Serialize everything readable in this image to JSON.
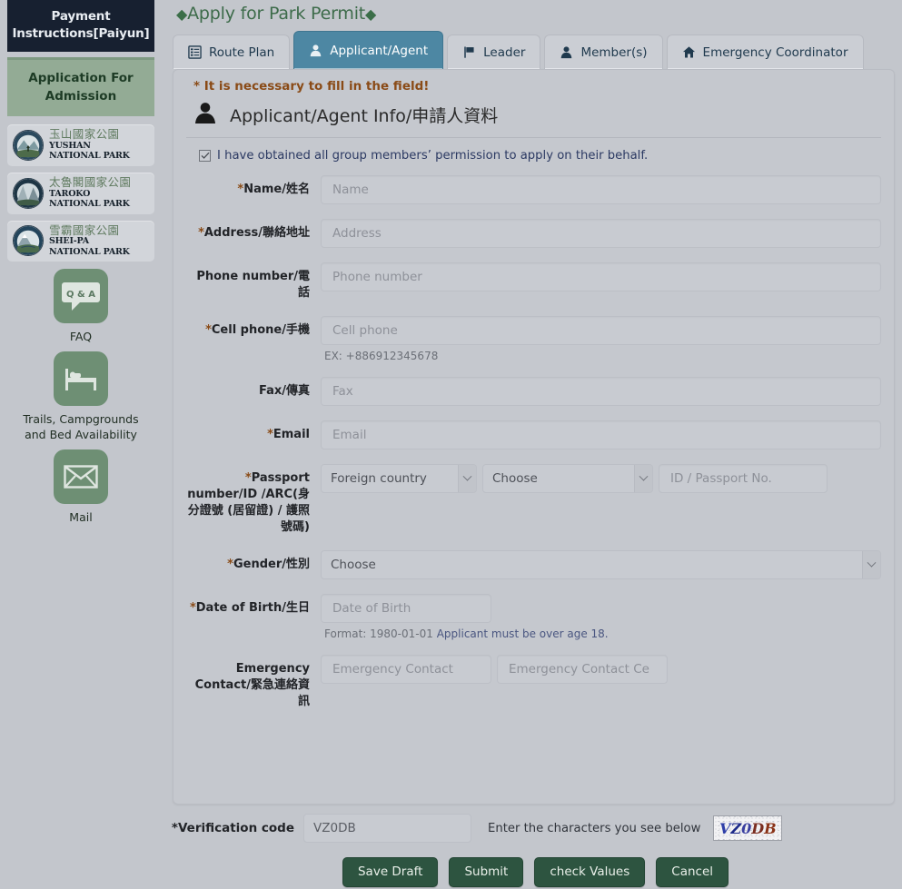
{
  "sidebar": {
    "payment_banner": "Payment Instructions[Paiyun]",
    "admission_banner": "Application For Admission",
    "parks": [
      {
        "cn": "玉山國家公園",
        "en_line1": "YUSHAN",
        "en_line2": "NATIONAL PARK",
        "icon": "yushan-park-seal-icon"
      },
      {
        "cn": "太魯閣國家公園",
        "en_line1": "TAROKO",
        "en_line2": "NATIONAL PARK",
        "icon": "taroko-park-seal-icon"
      },
      {
        "cn": "雪霸國家公園",
        "en_line1": "SHEI-PA",
        "en_line2": "NATIONAL PARK",
        "icon": "sheipa-park-seal-icon"
      }
    ],
    "quick_links": [
      {
        "label": "FAQ",
        "icon": "qa-speech-bubble-icon",
        "glyph": "Q & A"
      },
      {
        "label": "Trails, Campgrounds and Bed Availability",
        "icon": "bed-icon"
      },
      {
        "label": "Mail",
        "icon": "envelope-icon"
      }
    ]
  },
  "header": {
    "title": "Apply for Park Permit",
    "diamond_left": "◆",
    "diamond_right": "◆"
  },
  "tabs": [
    {
      "label": "Route Plan",
      "icon": "list-document-icon",
      "active": false
    },
    {
      "label": "Applicant/Agent",
      "icon": "person-icon",
      "active": true
    },
    {
      "label": "Leader",
      "icon": "flag-icon",
      "active": false
    },
    {
      "label": "Member(s)",
      "icon": "person-icon",
      "active": false
    },
    {
      "label": "Emergency Coordinator",
      "icon": "home-icon",
      "active": false
    }
  ],
  "form": {
    "required_note": "* It is necessary to fill in the field!",
    "section_title": "Applicant/Agent Info/申請人資料",
    "section_icon": "person-avatar-icon",
    "consent_label": "I have obtained all group members’ permission to apply on their behalf.",
    "consent_checked": true,
    "fields": {
      "name": {
        "label": "Name/姓名",
        "required": true,
        "placeholder": "Name",
        "value": ""
      },
      "address": {
        "label": "Address/聯絡地址",
        "required": true,
        "placeholder": "Address",
        "value": ""
      },
      "phone": {
        "label": "Phone number/電話",
        "required": false,
        "placeholder": "Phone number",
        "value": ""
      },
      "cell": {
        "label": "Cell phone/手機",
        "required": true,
        "placeholder": "Cell phone",
        "value": "",
        "hint": "EX: +886912345678"
      },
      "fax": {
        "label": "Fax/傳真",
        "required": false,
        "placeholder": "Fax",
        "value": ""
      },
      "email": {
        "label": "Email",
        "required": true,
        "placeholder": "Email",
        "value": ""
      },
      "passport": {
        "label": "Passport number/ID /ARC(身分證號 (居留證) / 護照號碼)",
        "required": true,
        "select_country": "Foreign country",
        "select_choose": "Choose",
        "placeholder": "ID / Passport No.",
        "value": ""
      },
      "gender": {
        "label": "Gender/性別",
        "required": true,
        "selected": "Choose"
      },
      "dob": {
        "label": "Date of Birth/生日",
        "required": true,
        "placeholder": "Date of Birth",
        "value": "",
        "hint_prefix": "Format: 1980-01-01 ",
        "hint_link": "Applicant must be over age 18."
      },
      "emergency": {
        "label": "Emergency Contact/緊急連絡資訊",
        "required": false,
        "placeholder_name": "Emergency Contact",
        "placeholder_cell": "Emergency Contact Ce",
        "value_name": "",
        "value_cell": ""
      }
    }
  },
  "verification": {
    "label": "Verification code",
    "required": true,
    "value": "VZ0DB",
    "instruction": "Enter the characters you see below",
    "captcha_text": "VZ0DB",
    "captcha_chars": [
      "V",
      "Z",
      "0",
      "D",
      "B"
    ]
  },
  "buttons": [
    {
      "label": "Save Draft",
      "name": "save-draft-button"
    },
    {
      "label": "Submit",
      "name": "submit-button"
    },
    {
      "label": "check Values",
      "name": "check-values-button"
    },
    {
      "label": "Cancel",
      "name": "cancel-button"
    }
  ],
  "colors": {
    "page_bg": "#c3c6cc",
    "active_tab": "#4d87a3",
    "button_green": "#2d5440",
    "title_green": "#3d6b4a",
    "required_orange": "#8a4b17",
    "banner_dark": "#172030",
    "banner_green": "#93ab95"
  }
}
